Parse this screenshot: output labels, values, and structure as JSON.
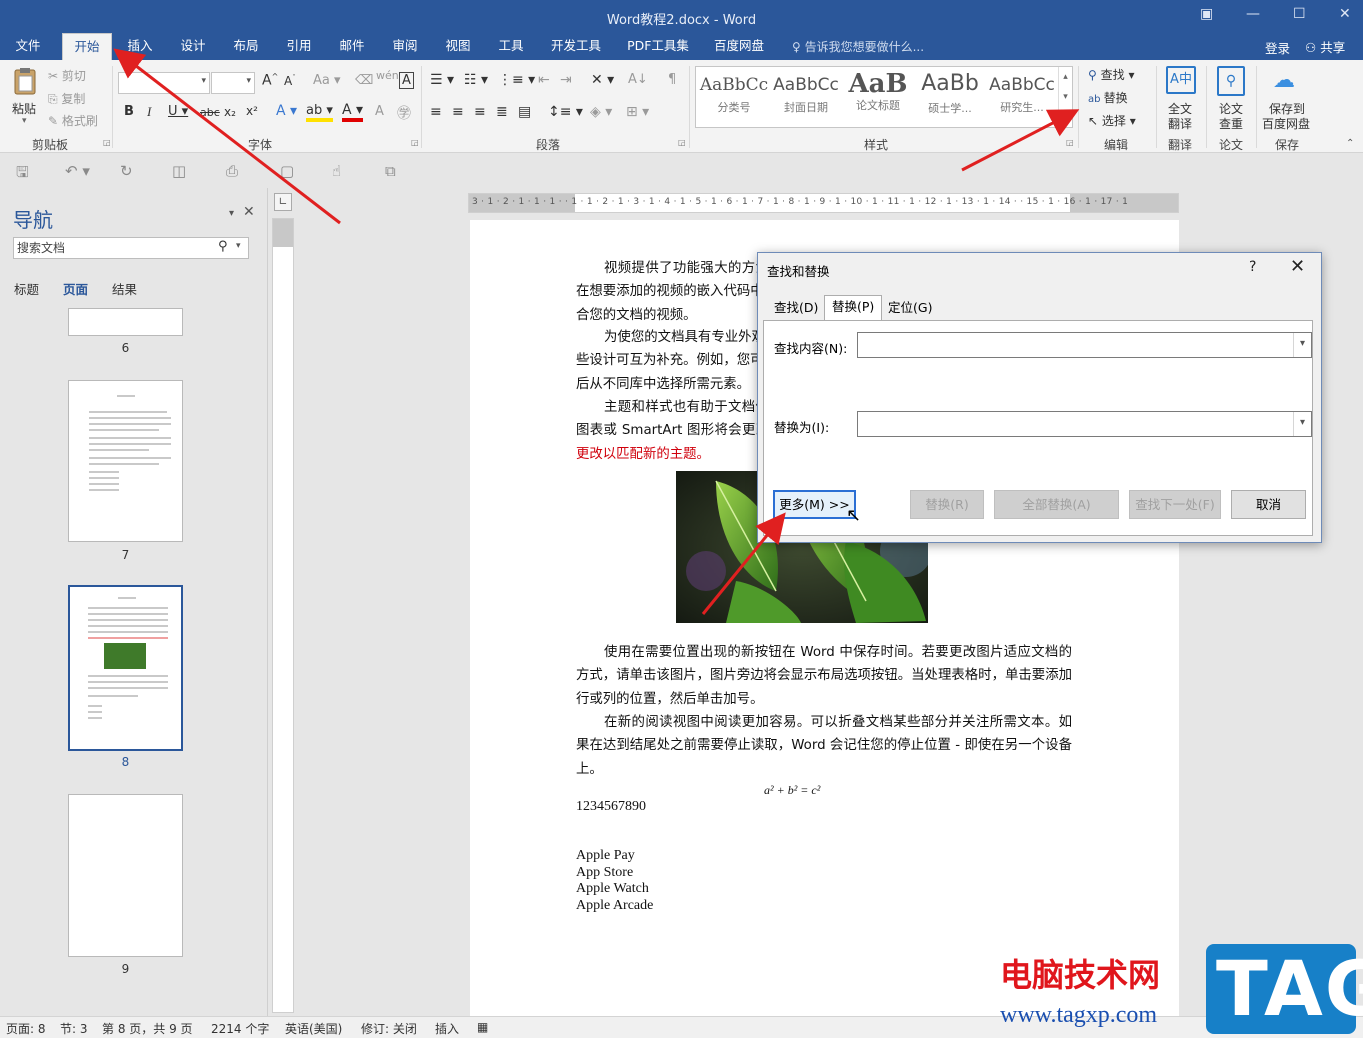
{
  "window": {
    "title": "Word教程2.docx - Word",
    "controls": [
      "▣",
      "—",
      "☐",
      "✕"
    ]
  },
  "tabs": [
    {
      "label": "文件"
    },
    {
      "label": "开始"
    },
    {
      "label": "插入"
    },
    {
      "label": "设计"
    },
    {
      "label": "布局"
    },
    {
      "label": "引用"
    },
    {
      "label": "邮件"
    },
    {
      "label": "审阅"
    },
    {
      "label": "视图"
    },
    {
      "label": "工具"
    },
    {
      "label": "开发工具"
    },
    {
      "label": "PDF工具集"
    },
    {
      "label": "百度网盘"
    }
  ],
  "tellme": "告诉我您想要做什么...",
  "login": "登录",
  "share": "共享",
  "ribbon": {
    "paste": "粘贴",
    "cut": "剪切",
    "copy": "复制",
    "format_painter": "格式刷",
    "clipboard_label": "剪贴板",
    "font_label": "字体",
    "paragraph_label": "段落",
    "styles_label": "样式",
    "editing_label": "编辑",
    "translate_label": "翻译",
    "paper_label": "论文",
    "save_label": "保存",
    "find": "查找",
    "replace": "替换",
    "select": "选择",
    "full_translate_1": "全文",
    "full_translate_2": "翻译",
    "paper_check_1": "论文",
    "paper_check_2": "查重",
    "save_baidu_1": "保存到",
    "save_baidu_2": "百度网盘",
    "styles": [
      {
        "preview": "AaBbCc",
        "name": "分类号"
      },
      {
        "preview": "AaBbCc",
        "name": "封面日期"
      },
      {
        "preview": "AaB",
        "name": "论文标题"
      },
      {
        "preview": "AaBb",
        "name": "硕士学..."
      },
      {
        "preview": "AaBbCc",
        "name": "研究生..."
      }
    ]
  },
  "nav": {
    "title": "导航",
    "search_placeholder": "搜索文档",
    "tabs": [
      "标题",
      "页面",
      "结果"
    ],
    "pages": [
      "6",
      "7",
      "8",
      "9"
    ]
  },
  "ruler": {
    "marks": "3 · 1 · 2 · 1 · 1 · 1 ·   · 1 · 1 · 2 · 1 · 3 · 1 · 4 · 1 · 5 · 1 · 6 · 1 · 7 · 1 · 8 · 1 · 9 · 1 · 10 · 1 · 11 · 1 · 12 · 1 · 13 · 1 · 14 ·   · 15 · 1 · 16 · 1 · 17 · 1"
  },
  "document": {
    "p1": "视频提供了功能强大的方法帮助您证明您的观点。当您单击联机视频时，可以在想要添加的视频的嵌入代码中进行粘贴。您也可以键入一个关键字以联机搜索最适合您的文档的视频。",
    "p2": "为使您的文档具有专业外观，Word 提供了页眉、页脚、封面和文本框设计，这些设计可互为补充。例如，您可以添加匹配的封面、页眉和提要栏。单击“插入”，然后从不同库中选择所需元素。",
    "p3": "主题和样式也有助于文档保持协调。当您单击设计并选择新的主题时，图片、图表或 SmartArt 图形将会更改以匹配新的主题。当应用样式时，您的标题会进",
    "p3_red": "行更改以匹配新的主题。",
    "p4": "使用在需要位置出现的新按钮在 Word 中保存时间。若要更改图片适应文档的方式，请单击该图片，图片旁边将会显示布局选项按钮。当处理表格时，单击要添加行或列的位置，然后单击加号。",
    "p5": "在新的阅读视图中阅读更加容易。可以折叠文档某些部分并关注所需文本。如果在达到结尾处之前需要停止读取，Word 会记住您的停止位置 - 即使在另一个设备上。",
    "equation": "a² + b² = c²",
    "numbers": "1234567890",
    "list": [
      "Apple Pay",
      "App Store",
      "Apple Watch",
      "Apple Arcade"
    ]
  },
  "dialog": {
    "title": "查找和替换",
    "help": "?",
    "close": "✕",
    "tabs": [
      "查找(D)",
      "替换(P)",
      "定位(G)"
    ],
    "find_label": "查找内容(N):",
    "find_value": "",
    "replace_label": "替换为(I):",
    "replace_value": "",
    "more_button": "更多(M) >>",
    "replace_button": "替换(R)",
    "replace_all_button": "全部替换(A)",
    "find_next_button": "查找下一处(F)",
    "cancel_button": "取消"
  },
  "status": {
    "page": "页面: 8",
    "section": "节: 3",
    "page_of": "第 8 页，共 9 页",
    "words": "2214 个字",
    "language": "英语(美国)",
    "track": "修订: 关闭",
    "insert": "插入"
  },
  "watermark": {
    "cn": "电脑技术网",
    "url": "www.tagxp.com",
    "tag": "TAG"
  },
  "colors": {
    "brand": "#2b579a",
    "arrow": "#e02020",
    "red_text": "#d0000c"
  }
}
